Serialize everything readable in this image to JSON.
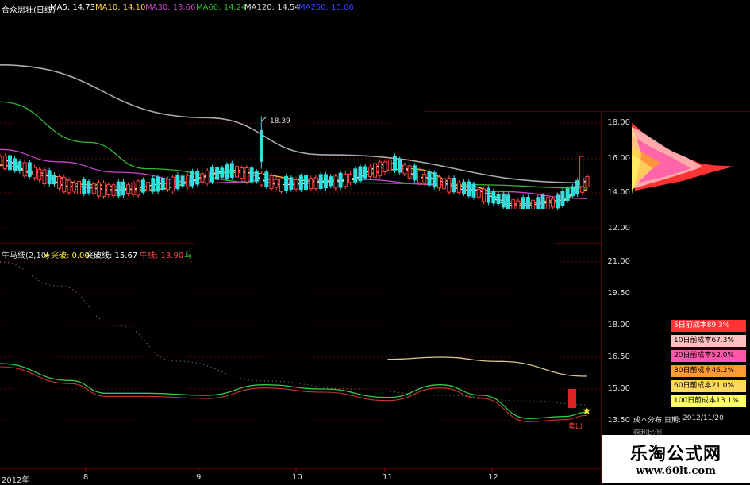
{
  "header": {
    "title": "合众思壮(日线)",
    "ma5": "MA5: 14.73",
    "ma10": "MA10: 14.10",
    "ma30": "MA30: 13.66",
    "ma60": "MA60: 14.24",
    "ma120": "MA120: 14.54",
    "ma250": "MA250: 15.06"
  },
  "indicator": {
    "name": "牛马线(2,10)",
    "breakout": "★突破: 0.00",
    "breakout_line": "突破线: 15.67",
    "niu_line": "牛线: 13.90",
    "ma_line": "马"
  },
  "price_axis": [
    "18.00",
    "16.00",
    "14.00",
    "12.00"
  ],
  "indicator_axis": [
    "21.00",
    "19.50",
    "18.00",
    "16.50",
    "15.00",
    "13.50"
  ],
  "x_axis": [
    "2012年",
    "8",
    "9",
    "10",
    "11",
    "12"
  ],
  "annotations": {
    "high_label": "18.39",
    "sell_label": "卖出"
  },
  "cost_legend": [
    {
      "label": "5日前成本89.3%",
      "bg": "#ff3333",
      "fg": "#ffffff"
    },
    {
      "label": "10日前成本67.3%",
      "bg": "#ffc0c0",
      "fg": "#000000"
    },
    {
      "label": "20日前成本52.0%",
      "bg": "#ff55aa",
      "fg": "#000000"
    },
    {
      "label": "30日前成本46.2%",
      "bg": "#ff9933",
      "fg": "#000000"
    },
    {
      "label": "60日前成本21.0%",
      "bg": "#ffd860",
      "fg": "#000000"
    },
    {
      "label": "100日前成本13.1%",
      "bg": "#ffff66",
      "fg": "#000000"
    }
  ],
  "cost_panel": {
    "title": "成本分布,日期:",
    "date": "2012/11/20",
    "sub": "获利比例"
  },
  "watermark": {
    "title": "乐淘公式网",
    "url": "www.60lt.com"
  },
  "colors": {
    "up": "#ff4444",
    "down": "#33dddd",
    "ma5": "#ffffff",
    "ma10": "#ffd040",
    "ma30": "#cc44cc",
    "ma60": "#33bb33",
    "ma120": "#aaaaaa",
    "ma250": "#3344ff",
    "grid": "#aa0000"
  },
  "chart_data": [
    {
      "type": "line",
      "title": "合众思壮(日线)",
      "ylim": [
        11.5,
        19.0
      ],
      "y_ticks": [
        18.0,
        16.0,
        14.0,
        12.0
      ],
      "series": [
        {
          "name": "MA120",
          "x": [
            0,
            35,
            55,
            100
          ],
          "values": [
            21.3,
            18.3,
            16.2,
            14.6
          ]
        },
        {
          "name": "MA60",
          "x": [
            0,
            15,
            25,
            45,
            60,
            80,
            100
          ],
          "values": [
            19.2,
            16.9,
            15.4,
            14.6,
            14.6,
            14.5,
            14.3
          ]
        },
        {
          "name": "MA30",
          "x": [
            0,
            10,
            20,
            35,
            50,
            60,
            75,
            85,
            100
          ],
          "values": [
            16.5,
            15.8,
            15.2,
            14.6,
            14.8,
            14.8,
            14.5,
            14.1,
            13.7
          ]
        },
        {
          "name": "MA10",
          "x": [
            0,
            8,
            15,
            25,
            40,
            55,
            70,
            80,
            88,
            95,
            100
          ],
          "values": [
            15.6,
            15.0,
            14.5,
            14.2,
            15.2,
            14.7,
            15.4,
            14.4,
            13.4,
            13.6,
            14.2
          ]
        },
        {
          "name": "MA5",
          "x": [
            0,
            6,
            12,
            20,
            30,
            40,
            48,
            58,
            67,
            72,
            80,
            88,
            95,
            100
          ],
          "values": [
            15.9,
            15.2,
            14.4,
            14.2,
            14.6,
            15.3,
            14.5,
            14.7,
            15.7,
            14.9,
            14.2,
            13.3,
            13.5,
            14.7
          ]
        }
      ]
    },
    {
      "type": "line",
      "title": "牛马线(2,10)",
      "ylim": [
        12.7,
        22.0
      ],
      "y_ticks": [
        21.0,
        19.5,
        18.0,
        16.5,
        15.0,
        13.5
      ],
      "series": [
        {
          "name": "牛线",
          "x": [
            0,
            12,
            18,
            25,
            35,
            45,
            55,
            66,
            75,
            82,
            90,
            96,
            100
          ],
          "values": [
            16.2,
            15.4,
            14.8,
            14.8,
            14.7,
            15.2,
            15.0,
            14.6,
            15.2,
            14.7,
            13.6,
            13.7,
            13.9
          ]
        },
        {
          "name": "突破线",
          "x": [
            66,
            75,
            85,
            100
          ],
          "values": [
            16.4,
            16.5,
            16.3,
            15.6
          ]
        }
      ]
    }
  ]
}
